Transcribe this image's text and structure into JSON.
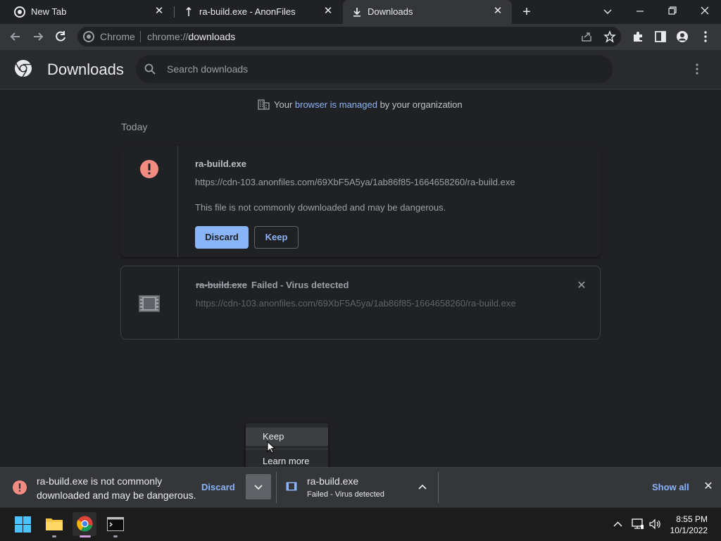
{
  "tabs": [
    {
      "title": "New Tab"
    },
    {
      "title": "ra-build.exe - AnonFiles"
    },
    {
      "title": "Downloads"
    }
  ],
  "toolbar": {
    "omnibox_label": "Chrome",
    "url_prefix": "chrome://",
    "url_path": "downloads"
  },
  "header": {
    "title": "Downloads",
    "search_placeholder": "Search downloads"
  },
  "managed": {
    "prefix": "Your ",
    "link": "browser is managed",
    "suffix": " by your organization"
  },
  "section_label": "Today",
  "downloads": [
    {
      "filename": "ra-build.exe",
      "url": "https://cdn-103.anonfiles.com/69XbF5A5ya/1ab86f85-1664658260/ra-build.exe",
      "warning": "This file is not commonly downloaded and may be dangerous.",
      "discard_label": "Discard",
      "keep_label": "Keep"
    },
    {
      "filename": "ra-build.exe",
      "status": "Failed - Virus detected",
      "url": "https://cdn-103.anonfiles.com/69XbF5A5ya/1ab86f85-1664658260/ra-build.exe"
    }
  ],
  "popup_menu": {
    "keep": "Keep",
    "learn_more": "Learn more"
  },
  "shelf": {
    "warning_text": "ra-build.exe is not commonly downloaded and may be dangerous.",
    "discard_label": "Discard",
    "file_name": "ra-build.exe",
    "file_status": "Failed - Virus detected",
    "show_all": "Show all"
  },
  "taskbar": {
    "time": "8:55 PM",
    "date": "10/1/2022"
  },
  "colors": {
    "accent": "#8ab4f8",
    "danger": "#f28b82",
    "background": "#202124"
  }
}
